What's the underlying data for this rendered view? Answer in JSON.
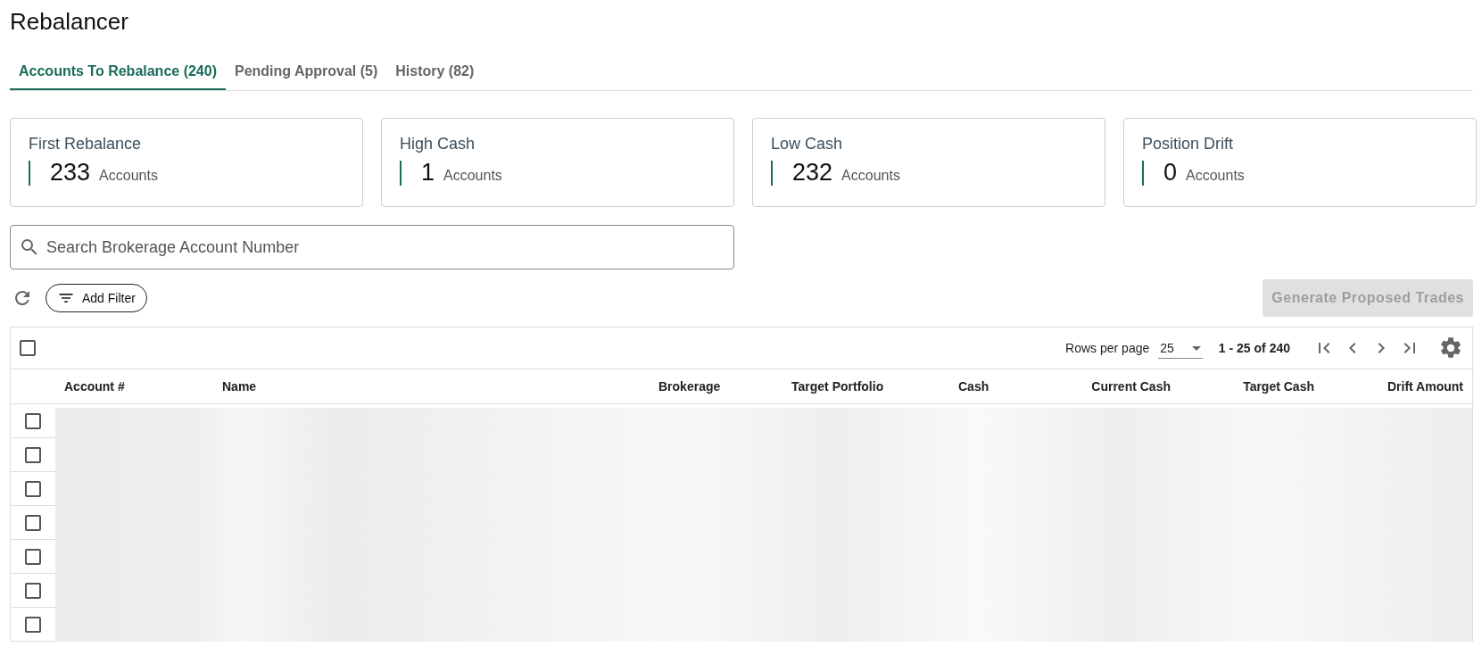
{
  "title": "Rebalancer",
  "tabs": [
    {
      "label": "Accounts To Rebalance (240)",
      "selected": true
    },
    {
      "label": "Pending Approval (5)",
      "selected": false
    },
    {
      "label": "History (82)",
      "selected": false
    }
  ],
  "cards": [
    {
      "title": "First Rebalance",
      "count": "233",
      "unit": "Accounts"
    },
    {
      "title": "High Cash",
      "count": "1",
      "unit": "Accounts"
    },
    {
      "title": "Low Cash",
      "count": "232",
      "unit": "Accounts"
    },
    {
      "title": "Position Drift",
      "count": "0",
      "unit": "Accounts"
    }
  ],
  "search": {
    "placeholder": "Search Brokerage Account Number"
  },
  "filter_button": "Add Filter",
  "generate_button": {
    "label": "Generate Proposed Trades",
    "disabled": true
  },
  "table": {
    "select_all_checked": false,
    "pagination": {
      "rows_per_page_label": "Rows per page",
      "rows_per_page": "25",
      "range": "1 - 25 of 240"
    },
    "columns": [
      "Account #",
      "Name",
      "Brokerage",
      "Target Portfolio",
      "Cash",
      "Current Cash",
      "Target Cash",
      "Drift Amount"
    ],
    "rows": [
      {
        "selected": false
      },
      {
        "selected": false
      },
      {
        "selected": false
      },
      {
        "selected": false
      },
      {
        "selected": false
      },
      {
        "selected": false
      },
      {
        "selected": false
      }
    ]
  }
}
